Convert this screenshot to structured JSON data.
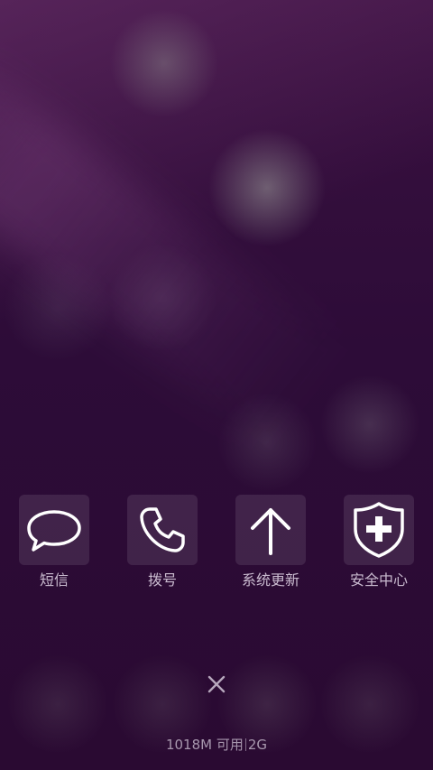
{
  "shortcuts": [
    {
      "label": "短信",
      "icon": "message-bubble-icon"
    },
    {
      "label": "拨号",
      "icon": "phone-icon"
    },
    {
      "label": "系统更新",
      "icon": "arrow-up-icon"
    },
    {
      "label": "安全中心",
      "icon": "shield-plus-icon"
    }
  ],
  "close": {
    "icon": "close-icon"
  },
  "memory": {
    "available": "1018M 可用",
    "total": "2G"
  },
  "colors": {
    "background": "#2c0b35",
    "tile": "rgba(255,255,255,0.10)",
    "icon": "#ffffff"
  }
}
